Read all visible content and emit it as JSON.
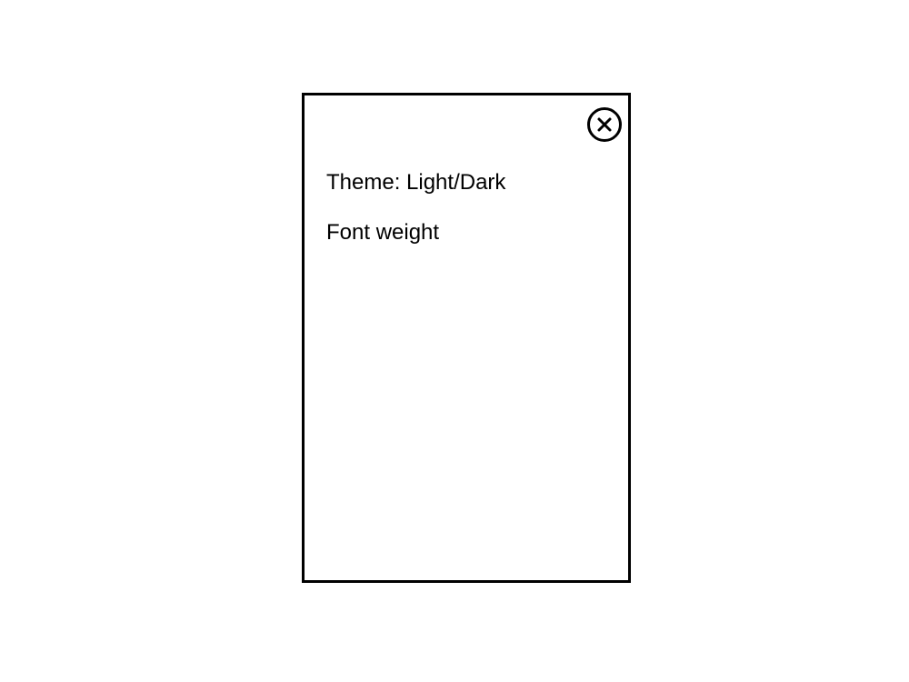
{
  "settings_panel": {
    "close_icon": "close-circle-x-icon",
    "items": [
      {
        "label": "Theme: Light/Dark"
      },
      {
        "label": "Font weight"
      }
    ]
  },
  "colors": {
    "border": "#000000",
    "background": "#ffffff",
    "text": "#000000"
  }
}
